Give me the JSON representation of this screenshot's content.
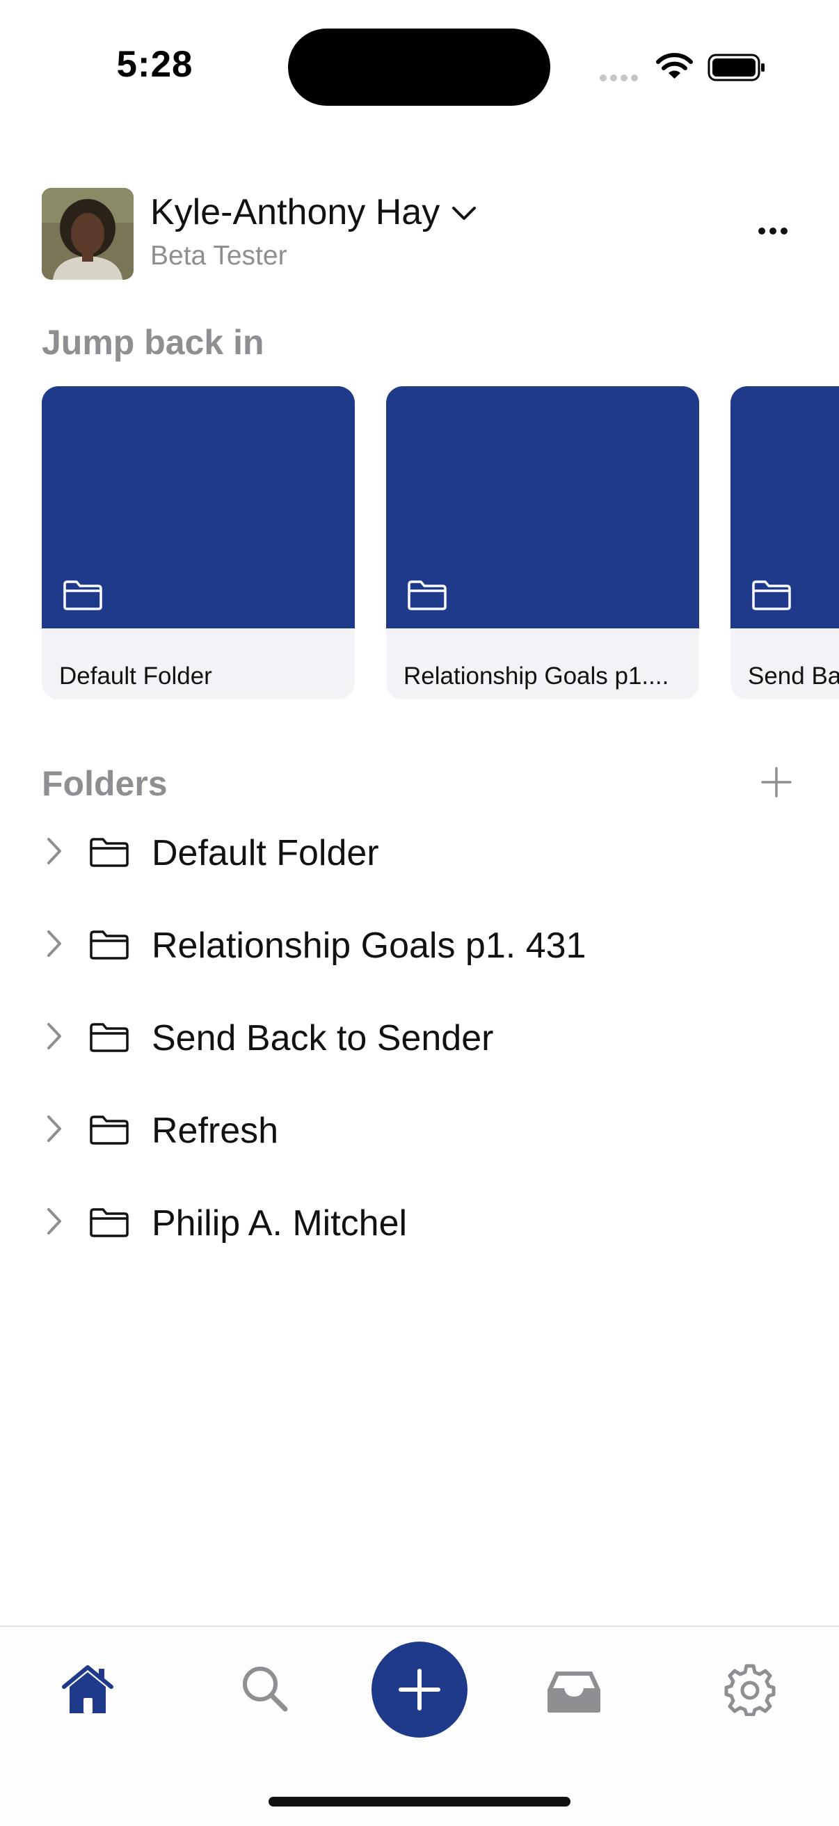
{
  "status_bar": {
    "time": "5:28"
  },
  "header": {
    "user_name": "Kyle-Anthony Hay",
    "user_role": "Beta Tester",
    "icons": {
      "chevron": "chevron-down-icon",
      "more": "ellipsis-icon"
    }
  },
  "jump_back_in": {
    "title": "Jump back in",
    "cards": [
      {
        "label": "Default Folder"
      },
      {
        "label": "Relationship Goals p1...."
      },
      {
        "label": "Send Ba"
      }
    ]
  },
  "folders": {
    "title": "Folders",
    "items": [
      {
        "label": "Default Folder"
      },
      {
        "label": "Relationship Goals p1. 431"
      },
      {
        "label": "Send Back to Sender"
      },
      {
        "label": "Refresh"
      },
      {
        "label": "Philip A. Mitchel"
      }
    ]
  },
  "tab_bar": {
    "tabs": [
      "home-icon",
      "search-icon",
      "plus-icon",
      "inbox-icon",
      "gear-icon"
    ],
    "active": "home-icon"
  },
  "colors": {
    "accent": "#1f3a8a",
    "card_footer": "#f2f2f7",
    "secondary_text": "#8e8e93",
    "inactive_icon": "#8e8e93"
  }
}
